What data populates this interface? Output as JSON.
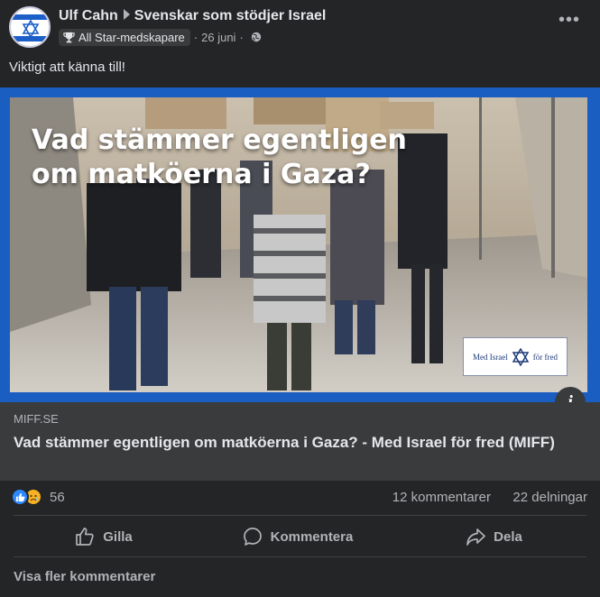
{
  "post": {
    "author": "Ulf Cahn",
    "group": "Svenskar som stödjer Israel",
    "badge": "All Star-medskapare",
    "date": "26 juni",
    "separator": "·",
    "more_icon": "more-dots-icon",
    "caption": "Viktigt att känna till!"
  },
  "link": {
    "image_headline_line1": "Vad stämmer egentligen",
    "image_headline_line2": "om matköerna i Gaza?",
    "logo_left": "Med Israel",
    "logo_right": "för fred",
    "info_glyph": "i",
    "domain": "MIFF.SE",
    "title": "Vad stämmer egentligen om matköerna i Gaza? - Med Israel för fred (MIFF)"
  },
  "stats": {
    "reactions_count": "56",
    "comments": "12 kommentarer",
    "shares": "22 delningar"
  },
  "actions": {
    "like": "Gilla",
    "comment": "Kommentera",
    "share": "Dela"
  },
  "footer": {
    "more_comments": "Visa fler kommentarer"
  },
  "colors": {
    "background": "#242526",
    "link_frame": "#1a5ec2",
    "like_blue": "#2d88ff",
    "sad_yellow": "#f7b125"
  }
}
